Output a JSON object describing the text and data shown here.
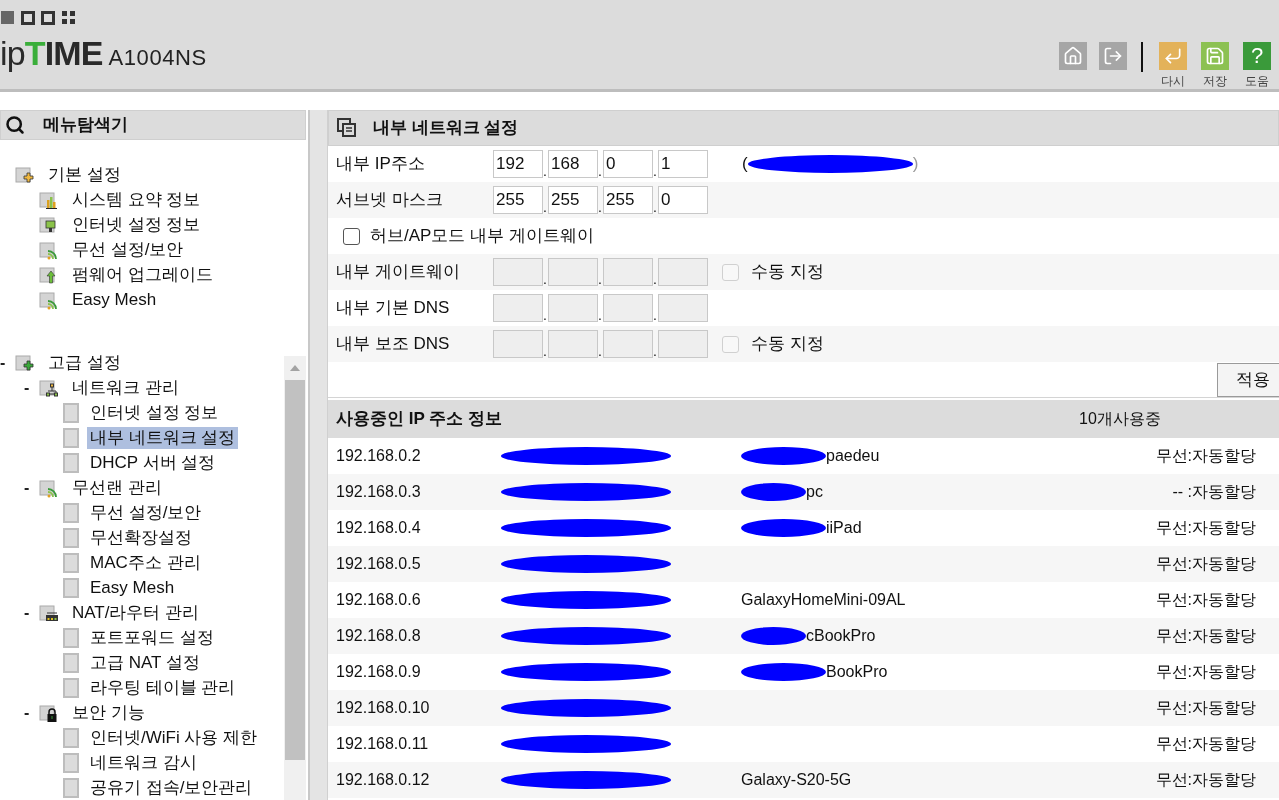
{
  "header": {
    "brand": "ipTIME",
    "model": "A1004NS",
    "nav": [
      {
        "kind": "home"
      },
      {
        "kind": "logout"
      }
    ],
    "actions": [
      {
        "kind": "undo",
        "label": "다시",
        "color": "#e3b25a"
      },
      {
        "kind": "save",
        "label": "저장",
        "color": "#8cc152"
      },
      {
        "kind": "help",
        "glyph": "?",
        "label": "도움",
        "color": "#3a9a3a"
      }
    ]
  },
  "sidebar": {
    "title": "메뉴탐색기",
    "groups": [
      {
        "label": "기본 설정",
        "kind": "folder-orange",
        "children": [
          {
            "label": "시스템 요약 정보",
            "kind": "chart",
            "selected": false
          },
          {
            "label": "인터넷 설정 정보",
            "kind": "monitor",
            "selected": false
          },
          {
            "label": "무선 설정/보안",
            "kind": "wifi",
            "selected": false
          },
          {
            "label": "펌웨어 업그레이드",
            "kind": "upload",
            "selected": false
          },
          {
            "label": "Easy Mesh",
            "kind": "wifi",
            "selected": false
          }
        ]
      },
      {
        "label": "고급 설정",
        "toggle": "-",
        "kind": "folder-green",
        "children": [
          {
            "label": "네트워크 관리",
            "toggle": "-",
            "kind": "network",
            "children": [
              {
                "label": "인터넷 설정 정보",
                "kind": "page",
                "selected": false
              },
              {
                "label": "내부 네트워크 설정",
                "kind": "page",
                "selected": true
              },
              {
                "label": "DHCP 서버 설정",
                "kind": "page",
                "selected": false
              }
            ]
          },
          {
            "label": "무선랜 관리",
            "toggle": "-",
            "kind": "wifi",
            "children": [
              {
                "label": "무선 설정/보안",
                "kind": "page",
                "selected": false
              },
              {
                "label": "무선확장설정",
                "kind": "page",
                "selected": false
              },
              {
                "label": "MAC주소 관리",
                "kind": "page",
                "selected": false
              },
              {
                "label": "Easy Mesh",
                "kind": "page",
                "selected": false
              }
            ]
          },
          {
            "label": "NAT/라우터 관리",
            "toggle": "-",
            "kind": "router",
            "children": [
              {
                "label": "포트포워드 설정",
                "kind": "page",
                "selected": false
              },
              {
                "label": "고급 NAT 설정",
                "kind": "page",
                "selected": false
              },
              {
                "label": "라우팅 테이블 관리",
                "kind": "page",
                "selected": false
              }
            ]
          },
          {
            "label": "보안 기능",
            "toggle": "-",
            "kind": "lock",
            "children": [
              {
                "label": "인터넷/WiFi 사용 제한",
                "kind": "page",
                "selected": false
              },
              {
                "label": "네트워크 감시",
                "kind": "page",
                "selected": false
              },
              {
                "label": "공유기 접속/보안관리",
                "kind": "page",
                "selected": false
              }
            ]
          }
        ]
      }
    ]
  },
  "form": {
    "title": "내부 네트워크 설정",
    "rows": [
      {
        "kind": "ip",
        "label": "내부 IP주소",
        "octets": [
          "192",
          "168",
          "0",
          "1"
        ],
        "separators": [
          ".",
          ".",
          "."
        ],
        "disabled": false,
        "note": {
          "prefix": "(",
          "suffix": ")"
        }
      },
      {
        "kind": "ip",
        "label": "서브넷 마스크",
        "octets": [
          "255",
          "255",
          "255",
          "0"
        ],
        "separators": [
          ".",
          ".",
          "."
        ],
        "disabled": false
      },
      {
        "kind": "checkbox",
        "label": "허브/AP모드 내부 게이트웨이",
        "checked": false
      },
      {
        "kind": "ip",
        "label": "내부 게이트웨이",
        "separators": [
          ".",
          ".",
          "."
        ],
        "disabled": true,
        "manual": {
          "label": "수동 지정",
          "checked": false
        }
      },
      {
        "kind": "ip",
        "label": "내부 기본 DNS",
        "separators": [
          ".",
          ".",
          "."
        ],
        "disabled": true
      },
      {
        "kind": "ip",
        "label": "내부 보조 DNS",
        "separators": [
          ".",
          ".",
          "."
        ],
        "disabled": true,
        "manual": {
          "label": "수동 지정",
          "checked": false
        }
      }
    ],
    "apply": "적용"
  },
  "table": {
    "title": "사용중인 IP 주소 정보",
    "count": "10개사용중",
    "rows": [
      {
        "ip": "192.168.0.2",
        "name": "paedeu",
        "name_redacted": true,
        "type": "무선:자동할당"
      },
      {
        "ip": "192.168.0.3",
        "name": "pc",
        "name_redacted": true,
        "type": "-- :자동할당"
      },
      {
        "ip": "192.168.0.4",
        "name": "iiPad",
        "name_redacted": true,
        "type": "무선:자동할당"
      },
      {
        "ip": "192.168.0.5",
        "name_redacted": false,
        "type": "무선:자동할당"
      },
      {
        "ip": "192.168.0.6",
        "name": "GalaxyHomeMini-09AL",
        "name_redacted": false,
        "type": "무선:자동할당"
      },
      {
        "ip": "192.168.0.8",
        "name": "cBookPro",
        "name_redacted": true,
        "type": "무선:자동할당"
      },
      {
        "ip": "192.168.0.9",
        "name": "BookPro",
        "name_redacted": true,
        "type": "무선:자동할당"
      },
      {
        "ip": "192.168.0.10",
        "name_redacted": false,
        "type": "무선:자동할당"
      },
      {
        "ip": "192.168.0.11",
        "name_redacted": false,
        "type": "무선:자동할당"
      },
      {
        "ip": "192.168.0.12",
        "name": "Galaxy-S20-5G",
        "name_redacted": false,
        "type": "무선:자동할당"
      }
    ]
  }
}
